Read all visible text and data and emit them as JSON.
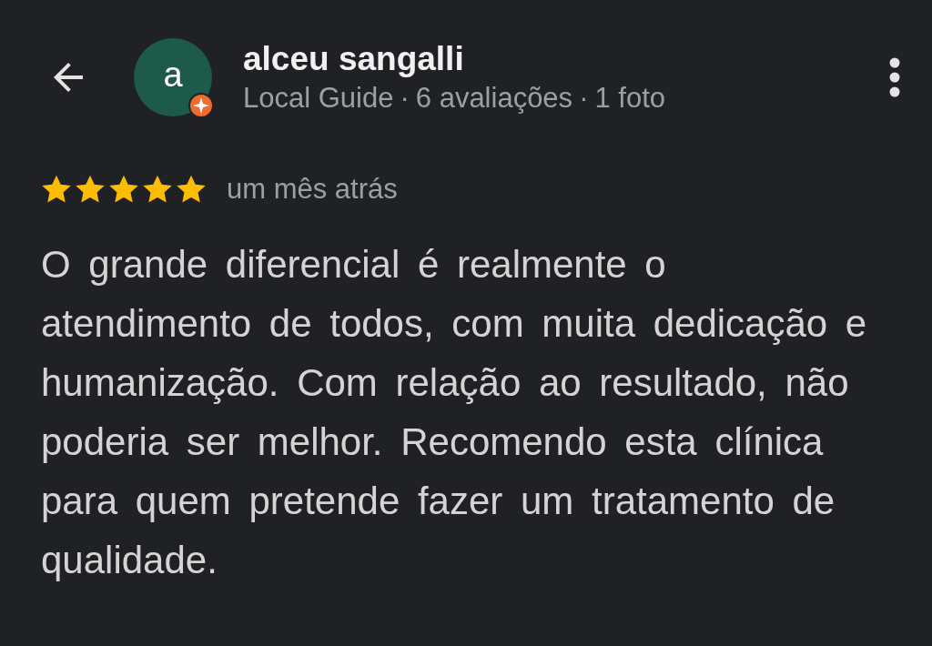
{
  "review": {
    "author": {
      "name": "alceu sangalli",
      "initial": "a",
      "details": [
        "Local Guide",
        "6 avaliações",
        "1 foto"
      ],
      "separator": "·"
    },
    "stars": 5,
    "time": "um mês atrás",
    "text": "O grande diferencial é realmente o atendimento de todos, com muita dedicação e humanização. Com relação ao resultado, não poderia ser melhor. Recomendo esta clínica para quem pretende fazer um tratamento de qualidade."
  }
}
